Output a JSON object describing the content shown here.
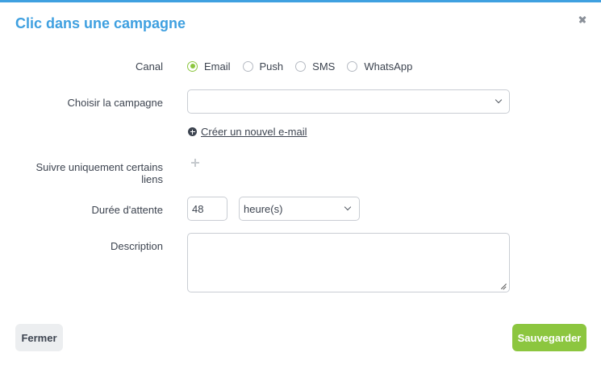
{
  "modal": {
    "title": "Clic dans une campagne",
    "accent_color": "#3fa0e0",
    "primary_color": "#8cc63f"
  },
  "form": {
    "canal": {
      "label": "Canal",
      "options": [
        "Email",
        "Push",
        "SMS",
        "WhatsApp"
      ],
      "selected": "Email"
    },
    "campaign": {
      "label": "Choisir la campagne",
      "value": "",
      "create_link": "Créer un nouvel e-mail"
    },
    "links": {
      "label": "Suivre uniquement certains liens"
    },
    "wait": {
      "label": "Durée d'attente",
      "value": "48",
      "unit": "heure(s)"
    },
    "description": {
      "label": "Description",
      "value": ""
    }
  },
  "footer": {
    "close_label": "Fermer",
    "save_label": "Sauvegarder"
  }
}
